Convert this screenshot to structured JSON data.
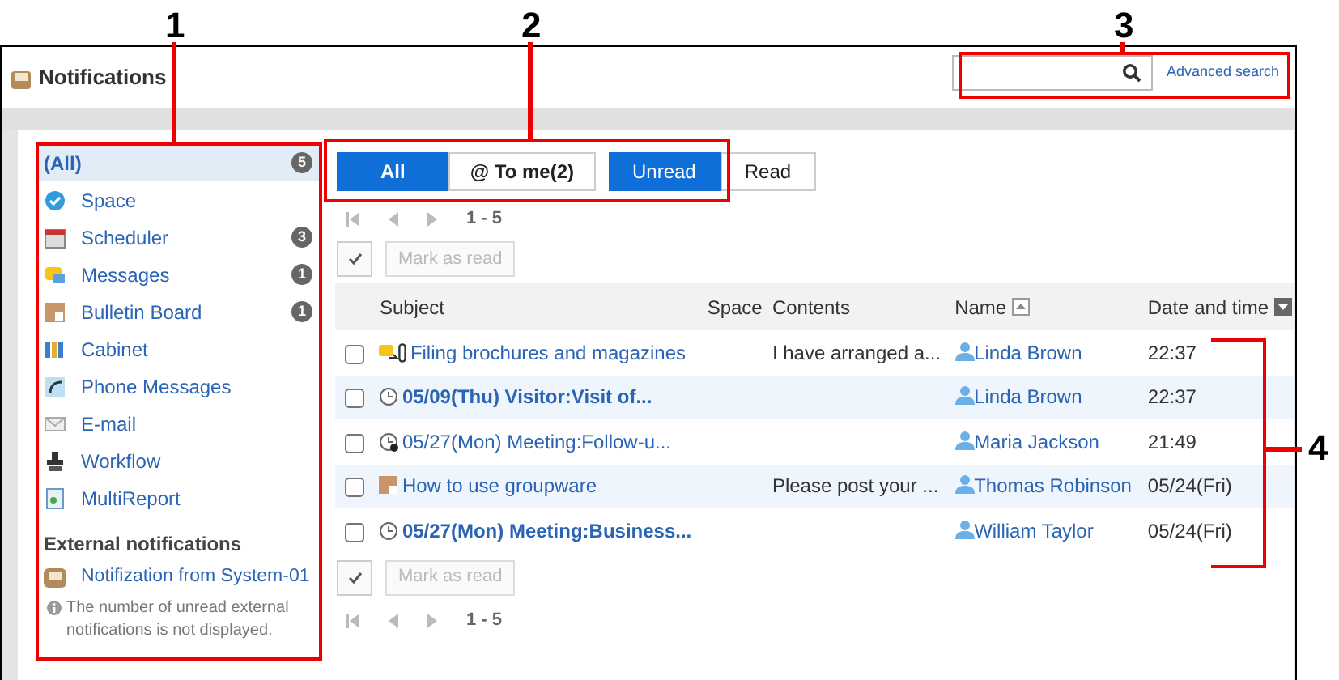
{
  "window": {
    "title": "Notifications"
  },
  "search": {
    "link": "Advanced search"
  },
  "sidebar": {
    "items": [
      {
        "kind": "all",
        "label": "(All)",
        "badge": "5",
        "selected": true
      },
      {
        "kind": "space",
        "label": "Space",
        "selected": false
      },
      {
        "kind": "scheduler",
        "label": "Scheduler",
        "badge": "3",
        "selected": false
      },
      {
        "kind": "messages",
        "label": "Messages",
        "badge": "1",
        "selected": false
      },
      {
        "kind": "bulletin",
        "label": "Bulletin Board",
        "badge": "1",
        "selected": false
      },
      {
        "kind": "cabinet",
        "label": "Cabinet",
        "selected": false
      },
      {
        "kind": "phone",
        "label": "Phone Messages",
        "selected": false
      },
      {
        "kind": "email",
        "label": "E-mail",
        "selected": false
      },
      {
        "kind": "workflow",
        "label": "Workflow",
        "selected": false
      },
      {
        "kind": "multireport",
        "label": "MultiReport",
        "selected": false
      }
    ],
    "external_heading": "External notifications",
    "external_items": [
      {
        "label": "Notifization from System-01"
      }
    ],
    "external_note": "The number of unread external notifications is not displayed."
  },
  "filters": [
    [
      {
        "label": "All",
        "selected": true
      },
      {
        "label": "@ To me(2)",
        "selected": false
      }
    ],
    [
      {
        "label": "Unread",
        "selected": true
      },
      {
        "label": "Read",
        "selected": false
      }
    ]
  ],
  "pager": {
    "top": "1 - 5",
    "bottom": "1 - 5"
  },
  "mark_button_top": "Mark as read",
  "mark_button_bottom": "Mark as read",
  "table": {
    "columns": [
      {
        "label": "Subject",
        "kind": "plain"
      },
      {
        "label": "Space",
        "kind": "plain"
      },
      {
        "label": "Contents",
        "kind": "plain"
      },
      {
        "label": "Name",
        "kind": "ascending"
      },
      {
        "label": "Date and time",
        "kind": "descending"
      }
    ],
    "rows": [
      {
        "kind": "message",
        "attachment": true,
        "new": false,
        "checked": false,
        "subject": "Filing brochures and magazines",
        "contents": "I have arranged a...",
        "name": "Linda Brown",
        "date": "22:37"
      },
      {
        "kind": "schedule",
        "attachment": false,
        "new": true,
        "checked": false,
        "subject": "05/09(Thu) Visitor:Visit of...",
        "contents": "",
        "name": "Linda Brown",
        "date": "22:37"
      },
      {
        "kind": "schedule-cancelled",
        "attachment": false,
        "new": false,
        "checked": false,
        "subject": "05/27(Mon) Meeting:Follow-u...",
        "contents": "",
        "name": "Maria Jackson",
        "date": "21:49"
      },
      {
        "kind": "bulletin",
        "attachment": false,
        "new": false,
        "checked": false,
        "subject": "How to use groupware",
        "contents": "Please post your ...",
        "name": "Thomas Robinson",
        "date": "05/24(Fri)"
      },
      {
        "kind": "schedule",
        "attachment": false,
        "new": true,
        "checked": false,
        "subject": "05/27(Mon) Meeting:Business...",
        "contents": "",
        "name": "William Taylor",
        "date": "05/24(Fri)"
      }
    ]
  },
  "callouts": [
    {
      "label": "1"
    },
    {
      "label": "2"
    },
    {
      "label": "3"
    },
    {
      "label": "4"
    }
  ]
}
